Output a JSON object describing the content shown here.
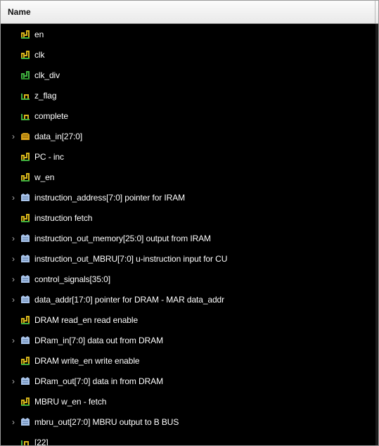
{
  "header": {
    "name_column": "Name"
  },
  "signals": [
    {
      "label": "en",
      "expandable": false,
      "icon": "logic-wire-icon"
    },
    {
      "label": "clk",
      "expandable": false,
      "icon": "logic-wire-icon"
    },
    {
      "label": "clk_div",
      "expandable": false,
      "icon": "logic-wire-green-icon"
    },
    {
      "label": "z_flag",
      "expandable": false,
      "icon": "logic-wire-partial-icon"
    },
    {
      "label": "complete",
      "expandable": false,
      "icon": "logic-wire-partial-icon"
    },
    {
      "label": "data_in[27:0]",
      "expandable": true,
      "icon": "bus-yellow-icon"
    },
    {
      "label": "PC - inc",
      "expandable": false,
      "icon": "logic-wire-icon"
    },
    {
      "label": "w_en",
      "expandable": false,
      "icon": "logic-wire-icon"
    },
    {
      "label": "instruction_address[7:0]  pointer for IRAM",
      "expandable": true,
      "icon": "bus-blue-icon"
    },
    {
      "label": "instruction fetch",
      "expandable": false,
      "icon": "logic-wire-icon"
    },
    {
      "label": "instruction_out_memory[25:0] output from IRAM",
      "expandable": true,
      "icon": "bus-blue-icon"
    },
    {
      "label": "instruction_out_MBRU[7:0] u-instruction input for CU",
      "expandable": true,
      "icon": "bus-blue-icon"
    },
    {
      "label": "control_signals[35:0]",
      "expandable": true,
      "icon": "bus-blue-icon"
    },
    {
      "label": "data_addr[17:0] pointer for DRAM - MAR data_addr",
      "expandable": true,
      "icon": "bus-blue-icon"
    },
    {
      "label": "DRAM read_en    read enable",
      "expandable": false,
      "icon": "logic-wire-icon"
    },
    {
      "label": "DRam_in[7:0] data out from DRAM",
      "expandable": true,
      "icon": "bus-blue-icon"
    },
    {
      "label": "DRAM write_en    write enable",
      "expandable": false,
      "icon": "logic-wire-icon"
    },
    {
      "label": "DRam_out[7:0] data in from DRAM",
      "expandable": true,
      "icon": "bus-blue-icon"
    },
    {
      "label": "MBRU w_en - fetch",
      "expandable": false,
      "icon": "logic-wire-icon"
    },
    {
      "label": "mbru_out[27:0]   MBRU output to B BUS",
      "expandable": true,
      "icon": "bus-blue-icon"
    },
    {
      "label": "[22]",
      "expandable": false,
      "icon": "logic-wire-partial-icon"
    }
  ]
}
